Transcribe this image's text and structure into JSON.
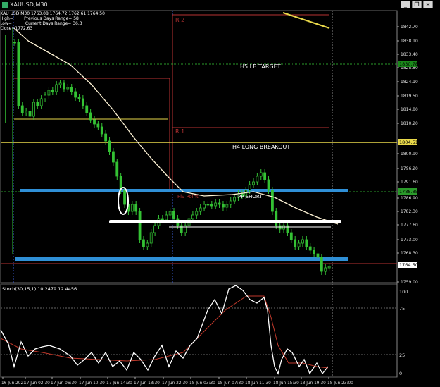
{
  "window": {
    "title": "XAUUSD,M30",
    "buttons": [
      "minimize",
      "restore",
      "close"
    ]
  },
  "info": {
    "line1": "XAU   USD M30  1763.08  1764.72  1762.61  1764.50",
    "line2_left": "High=",
    "line2_mid": "Previous Days Range= 58",
    "line3_left": "Low=",
    "line3_mid": "Current Days Range= 36.3",
    "line4": "Close=1772.63"
  },
  "price_scale": {
    "ticks": [
      "1842.70",
      "1838.10",
      "1833.40",
      "1828.80",
      "1824.10",
      "1819.50",
      "1814.80",
      "1810.20",
      "1800.90",
      "1796.20",
      "1791.60",
      "1786.90",
      "1782.30",
      "1777.60",
      "1773.00",
      "1768.30",
      "1759.00"
    ],
    "highlighted": [
      {
        "label": "1830.78",
        "color": "#1a8a1a"
      },
      {
        "label": "1804.51",
        "color": "#e8d84a"
      },
      {
        "label": "1788.85",
        "color": "#2a9a2a"
      },
      {
        "label": "1764.50",
        "color": "#ffffff"
      }
    ]
  },
  "annotations": {
    "r2": "R 2",
    "r1": "R 1",
    "h5": "H5 LB TARGET",
    "h4": "H4 LONG BREAKOUT",
    "pivot_point": "Piv Point",
    "pp_short": "PP SHORT"
  },
  "stoch": {
    "label": "Stoch(30,15,1) 10.2479 12.4456",
    "ticks": [
      "100",
      "75",
      "25",
      "0"
    ]
  },
  "time_axis": {
    "labels": [
      "16 Jun 2021",
      "17 Jun 02:30",
      "17 Jun 06:30",
      "17 Jun 10:30",
      "17 Jun 14:30",
      "17 Jun 18:30",
      "17 Jun 22:30",
      "18 Jun 03:30",
      "18 Jun 07:30",
      "18 Jun 11:30",
      "18 Jun 15:30",
      "18 Jun 19:30",
      "18 Jun 23:00"
    ]
  },
  "colors": {
    "candle": "#34c234",
    "ma": "#fff4d6",
    "stoch_main": "#ffffff",
    "stoch_signal": "#c0392b",
    "blue_zone": "#2f8fd6",
    "yellow_line": "#e8d84a",
    "red_line": "#b83232",
    "green_dashed": "#2a9a2a"
  }
}
